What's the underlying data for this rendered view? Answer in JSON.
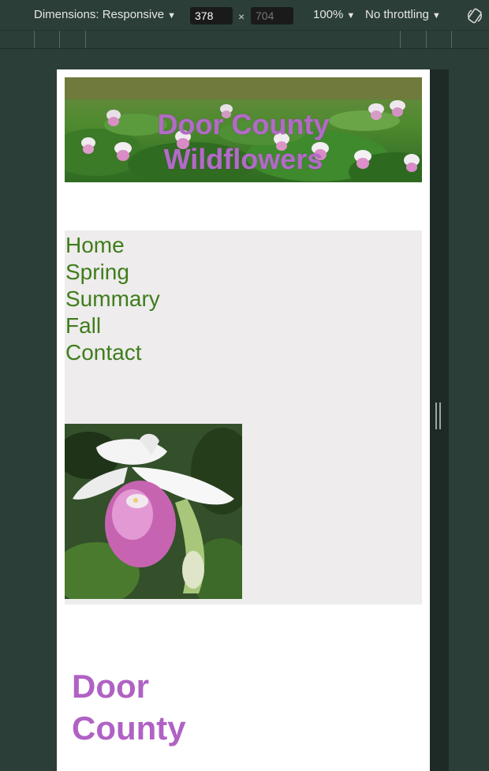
{
  "devtools": {
    "dimensions_label": "Dimensions: Responsive",
    "width_value": "378",
    "height_value": "704",
    "times_symbol": "×",
    "zoom_label": "100%",
    "throttling_label": "No throttling",
    "caret": "▼",
    "rotate_icon": "rotate-icon"
  },
  "site": {
    "banner_title_line1": "Door County",
    "banner_title_line2": "Wildflowers",
    "nav": [
      {
        "label": "Home"
      },
      {
        "label": "Spring"
      },
      {
        "label": "Summary"
      },
      {
        "label": "Fall"
      },
      {
        "label": "Contact"
      }
    ],
    "heading_line1": "Door",
    "heading_line2": "County"
  },
  "colors": {
    "devtools_bg": "#2b3e38",
    "nav_link": "#3f7d1c",
    "nav_panel_bg": "#eeecec",
    "title_purple": "#b26bc6"
  }
}
